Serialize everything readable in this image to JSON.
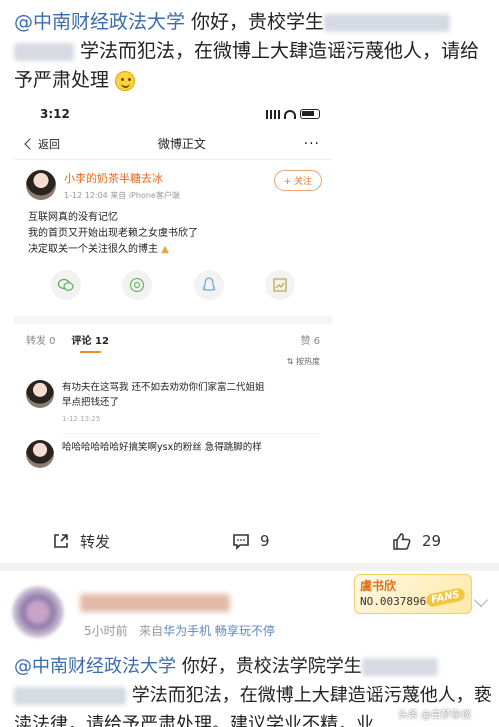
{
  "post1": {
    "mention": "@中南财经政法大学",
    "text_a": " 你好，贵校学生",
    "text_b": " 学法而犯法，在微博上大肆造谣污蔑他人，请给予严肃处理",
    "emoji": "smile-emoji"
  },
  "screenshot": {
    "status_time": "3:12",
    "back_label": "返回",
    "nav_title": "微博正文",
    "more": "···",
    "username": "小李的奶茶半糖去冰",
    "meta": "1-12 12:04  来自 iPhone客户端",
    "follow_label": "+ 关注",
    "body_lines": [
      "互联网真的没有记忆",
      "我的首页又开始出现老赖之女虞书欣了",
      "决定取关一个关注很久的博主"
    ],
    "tabs": {
      "repost": "转发 0",
      "comment": "评论 12",
      "like": "赞 6"
    },
    "sort_label": "按热度",
    "comments": [
      {
        "lines": [
          "有功夫在这骂我 还不如去劝劝你们家富二代姐姐",
          "早点把钱还了"
        ],
        "meta": "1-12 13:25"
      },
      {
        "lines": [
          "哈哈哈哈哈哈好搞笑啊ysx的粉丝 急得跳脚的样"
        ],
        "meta": ""
      }
    ]
  },
  "actions": {
    "repost_label": "转发",
    "comment_count": "9",
    "like_count": "29"
  },
  "post2": {
    "time": "5小时前",
    "source_prefix": "来自",
    "source": "华为手机 畅享玩不停",
    "badge_title": "虞书欣",
    "badge_no": "NO.0037896",
    "badge_tag": "FANS",
    "mention": "@中南财经政法大学",
    "text_a": " 你好，贵校法学院学生",
    "text_b": " 学法而犯法，在微博上大肆造谣污蔑他人，亵渎法律，请给予严肃处理。建议学业不精，业"
  },
  "watermark": "头条 @白梦杂谈"
}
